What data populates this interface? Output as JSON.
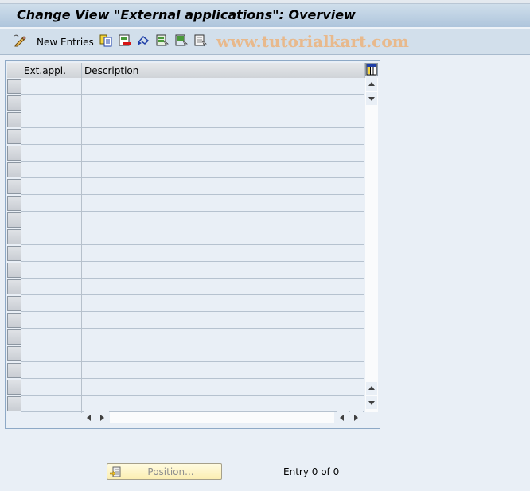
{
  "window": {
    "title": "Change View \"External applications\": Overview"
  },
  "toolbar": {
    "items": [
      {
        "icon": "edit-pencil-icon",
        "label": ""
      },
      {
        "icon": "new-entries",
        "label": "New Entries"
      },
      {
        "icon": "copy-icon",
        "label": ""
      },
      {
        "icon": "delete-icon",
        "label": ""
      },
      {
        "icon": "undo-icon",
        "label": ""
      },
      {
        "icon": "select-all-icon",
        "label": ""
      },
      {
        "icon": "select-block-icon",
        "label": ""
      },
      {
        "icon": "deselect-all-icon",
        "label": ""
      }
    ],
    "watermark": "www.tutorialkart.com"
  },
  "table": {
    "columns": [
      "Ext.appl.",
      "Description"
    ],
    "rows": [
      [
        "",
        ""
      ],
      [
        "",
        ""
      ],
      [
        "",
        ""
      ],
      [
        "",
        ""
      ],
      [
        "",
        ""
      ],
      [
        "",
        ""
      ],
      [
        "",
        ""
      ],
      [
        "",
        ""
      ],
      [
        "",
        ""
      ],
      [
        "",
        ""
      ],
      [
        "",
        ""
      ],
      [
        "",
        ""
      ],
      [
        "",
        ""
      ],
      [
        "",
        ""
      ],
      [
        "",
        ""
      ],
      [
        "",
        ""
      ],
      [
        "",
        ""
      ],
      [
        "",
        ""
      ],
      [
        "",
        ""
      ],
      [
        "",
        ""
      ]
    ]
  },
  "footer": {
    "position_button": "Position...",
    "entry_status": "Entry 0 of 0"
  },
  "colors": {
    "title_bar": "#aec5dc",
    "toolbar_bg": "#d2dfeb",
    "page_bg": "#e9eff6",
    "watermark": "#e8b98c",
    "position_button_bg": "#fbeeb2"
  }
}
